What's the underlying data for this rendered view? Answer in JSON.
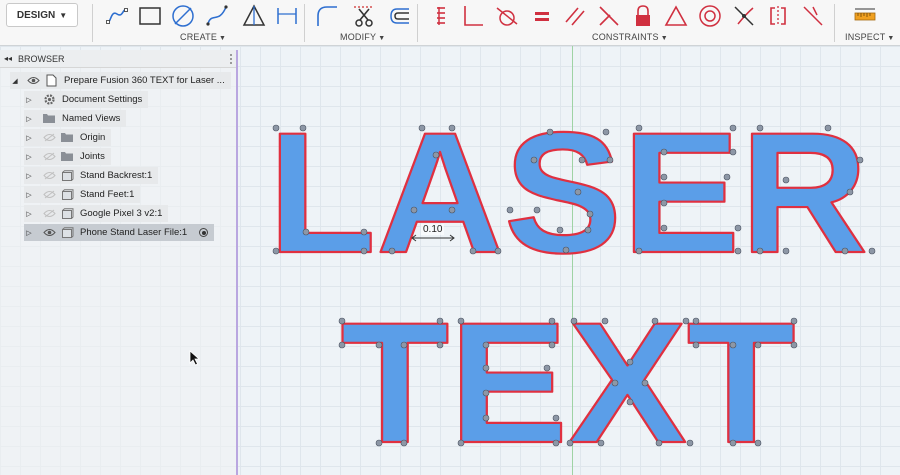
{
  "toolbar": {
    "workspace": "DESIGN",
    "groups": {
      "create": "CREATE",
      "modify": "MODIFY",
      "constraints": "CONSTRAINTS",
      "inspect": "INSPECT"
    }
  },
  "browser": {
    "title": "BROWSER",
    "items": [
      {
        "label": "Prepare Fusion 360 TEXT for Laser ..."
      },
      {
        "label": "Document Settings"
      },
      {
        "label": "Named Views"
      },
      {
        "label": "Origin"
      },
      {
        "label": "Joints"
      },
      {
        "label": "Stand Backrest:1"
      },
      {
        "label": "Stand Feet:1"
      },
      {
        "label": "Google Pixel 3 v2:1"
      },
      {
        "label": "Phone Stand Laser File:1"
      }
    ]
  },
  "sketch": {
    "line1": "LASER",
    "line2": "TEXT",
    "dimension": "0.10",
    "fill_color": "#5b9ee8",
    "outline_color": "#e03040"
  }
}
